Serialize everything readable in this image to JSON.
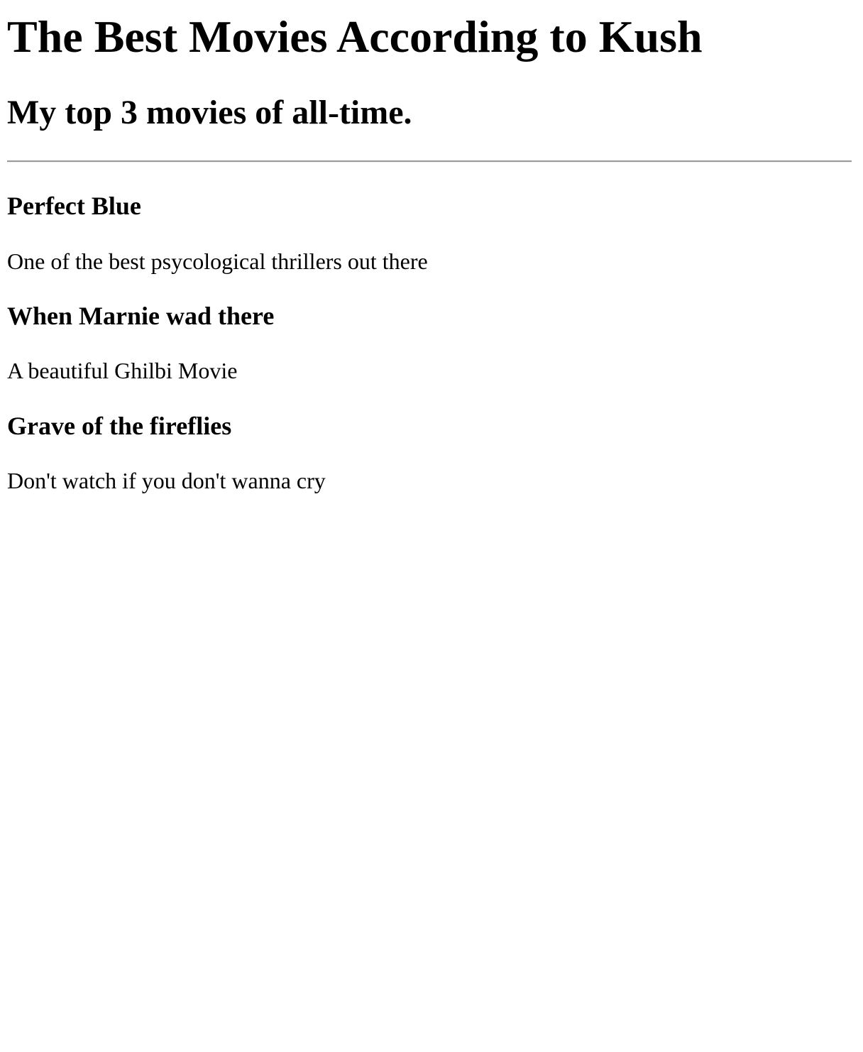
{
  "page": {
    "title": "The Best Movies According to Kush",
    "subtitle": "My top 3 movies of all-time."
  },
  "movies": [
    {
      "title": "Perfect Blue",
      "description": "One of the best psycological thrillers out there"
    },
    {
      "title": "When Marnie wad there",
      "description": "A beautiful Ghilbi Movie"
    },
    {
      "title": "Grave of the fireflies",
      "description": "Don't watch if you don't wanna cry"
    }
  ]
}
